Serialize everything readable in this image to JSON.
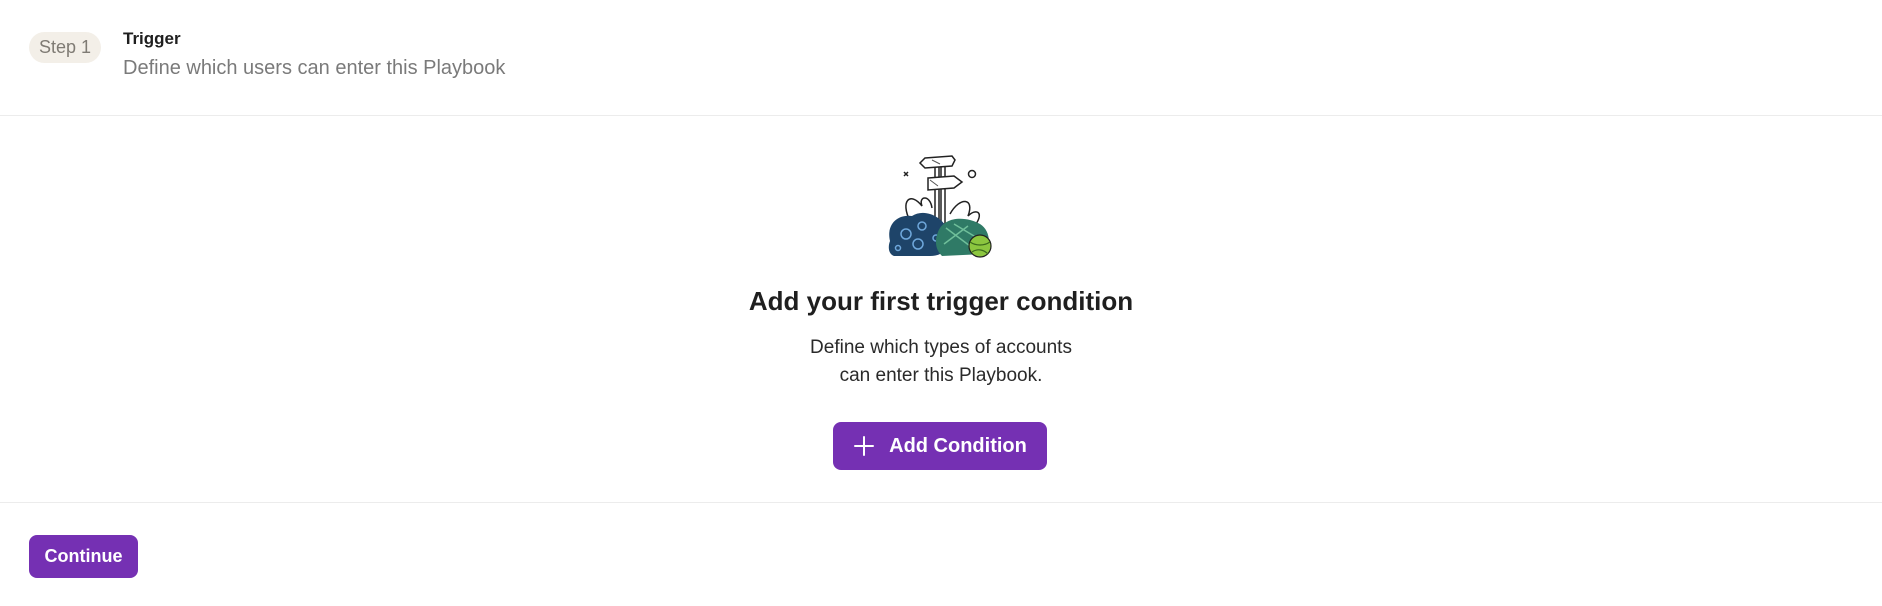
{
  "step": {
    "badge": "Step 1",
    "title": "Trigger",
    "subtitle": "Define which users can enter this Playbook"
  },
  "empty_state": {
    "illustration_icon": "signpost-illustration-icon",
    "title": "Add your first trigger condition",
    "description_line1": "Define which types of accounts",
    "description_line2": "can enter this Playbook.",
    "button_label": "Add Condition",
    "button_icon": "plus-icon"
  },
  "footer": {
    "continue_label": "Continue"
  },
  "colors": {
    "accent": "#7530b3",
    "badge_bg": "#f3efe8",
    "muted_text": "#7a7a7a"
  }
}
